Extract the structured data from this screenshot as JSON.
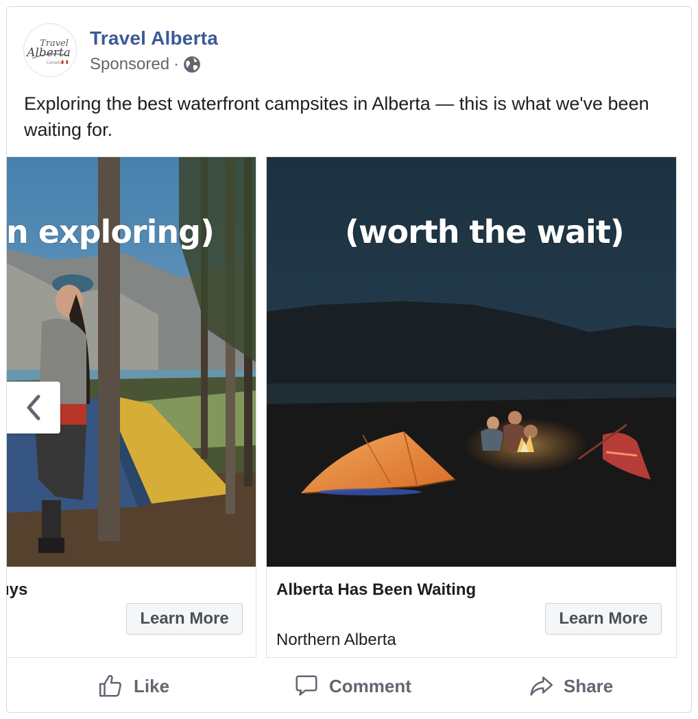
{
  "post": {
    "page_name": "Travel Alberta",
    "logo_text_line1": "Travel",
    "logo_text_line2": "Alberta",
    "logo_text_line3": "Canada",
    "sponsored": "Sponsored",
    "separator": "·",
    "message": "Exploring the best waterfront campsites in Alberta — this is what we've been waiting for."
  },
  "carousel": {
    "cards": [
      {
        "overlay": "n exploring)",
        "title": "ıys",
        "subtitle": "",
        "cta": "Learn More"
      },
      {
        "overlay": "(worth the wait)",
        "title": "Alberta Has Been Waiting",
        "subtitle": "Northern Alberta",
        "cta": "Learn More"
      }
    ]
  },
  "actions": {
    "like": "Like",
    "comment": "Comment",
    "share": "Share"
  },
  "colors": {
    "brand": "#3b5998",
    "secondary_text": "#606770"
  },
  "icons": [
    "globe-icon",
    "chevron-left-icon",
    "like-icon",
    "comment-icon",
    "share-icon"
  ]
}
